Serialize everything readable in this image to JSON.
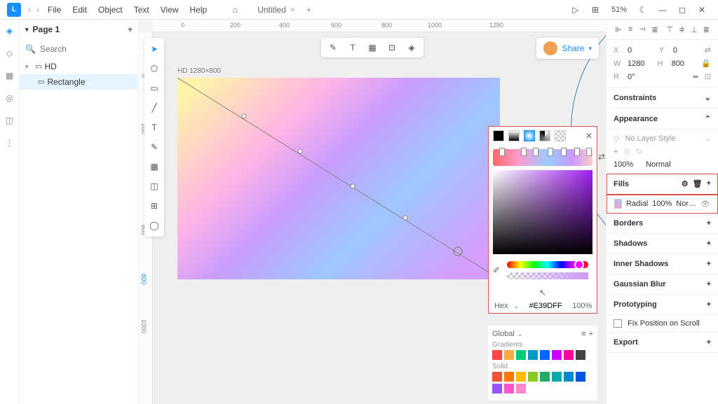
{
  "menu": {
    "file": "File",
    "edit": "Edit",
    "object": "Object",
    "text": "Text",
    "view": "View",
    "help": "Help"
  },
  "tab": {
    "title": "Untitled"
  },
  "zoom": "51%",
  "page": {
    "name": "Page 1"
  },
  "search": {
    "placeholder": "Search"
  },
  "tree": {
    "artboard": "HD",
    "rect": "Rectangle"
  },
  "artboard": {
    "label": "HD 1280×800"
  },
  "share": "Share",
  "props": {
    "x_label": "X",
    "x": "0",
    "y_label": "Y",
    "y": "0",
    "w_label": "W",
    "w": "1280",
    "h_label": "H",
    "h": "800",
    "r_label": "R",
    "r": "0°"
  },
  "sections": {
    "constraints": "Constraints",
    "appearance": "Appearance",
    "nolayer": "No Layer Style",
    "opacity": "100%",
    "blend": "Normal",
    "fills": "Fills",
    "fill_type": "Radial",
    "fill_opacity": "100%",
    "fill_blend": "Nor…",
    "borders": "Borders",
    "shadows": "Shadows",
    "inner": "Inner Shadows",
    "blur": "Gaussian Blur",
    "proto": "Prototyping",
    "fixpos": "Fix Position on Scroll",
    "export": "Export"
  },
  "color": {
    "hex_label": "Hex",
    "hex": "#E39DFF",
    "alpha": "100%",
    "global": "Global",
    "gradients": "Gradients",
    "solid": "Solid"
  },
  "chart_data": null
}
